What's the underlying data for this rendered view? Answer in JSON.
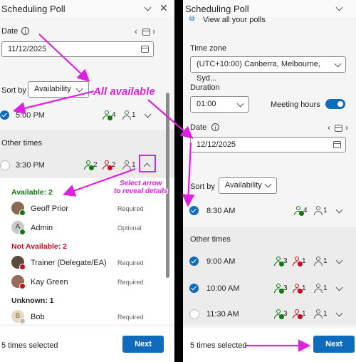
{
  "left": {
    "title": "Scheduling Poll",
    "date_label": "Date",
    "date_value": "11/12/2025",
    "sort_label": "Sort by",
    "sort_value": "Availability",
    "top_time": {
      "time": "5:00 PM",
      "available": "4",
      "unknown": "1"
    },
    "other_times_label": "Other times",
    "expanded_time": {
      "time": "3:30 PM",
      "available": "2",
      "not_available": "2",
      "unknown": "1"
    },
    "available_header": "Available: 2",
    "not_available_header": "Not Available: 2",
    "unknown_header": "Unknown: 1",
    "people": [
      {
        "name": "Geoff Prior",
        "role": "Required"
      },
      {
        "name": "Admin",
        "role": "Optional",
        "initial": "A"
      },
      {
        "name": "Trainer (Delegate/EA)",
        "role": "Required"
      },
      {
        "name": "Kay Green",
        "role": "Required"
      },
      {
        "name": "Bob",
        "role": "Required",
        "initial": "B"
      }
    ],
    "footer_text": "5 times selected",
    "next_label": "Next"
  },
  "right": {
    "title": "Scheduling Poll",
    "view_all": "View all your polls",
    "timezone_label": "Time zone",
    "timezone_value": "(UTC+10:00) Canberra, Melbourne, Syd...",
    "duration_label": "Duration",
    "duration_value": "01:00",
    "meeting_hours_label": "Meeting hours",
    "date_label": "Date",
    "date_value": "12/12/2025",
    "sort_label": "Sort by",
    "sort_value": "Availability",
    "top_time": {
      "time": "8:30 AM",
      "available": "4",
      "unknown": "1"
    },
    "other_times_label": "Other times",
    "times": [
      {
        "time": "9:00 AM",
        "available": "3",
        "not_available": "1",
        "unknown": "1"
      },
      {
        "time": "10:00 AM",
        "available": "3",
        "not_available": "1",
        "unknown": "1"
      },
      {
        "time": "11:30 AM",
        "available": "3",
        "not_available": "1",
        "unknown": "1"
      }
    ],
    "footer_text": "5 times selected",
    "next_label": "Next"
  },
  "annotations": {
    "all_available": "All available",
    "select_arrow": "Select arrow\nto reveal details"
  },
  "colors": {
    "accent": "#0f6cbd",
    "annotation": "#e020e0",
    "available": "#0e7a0d",
    "not_available": "#c50f1f"
  }
}
